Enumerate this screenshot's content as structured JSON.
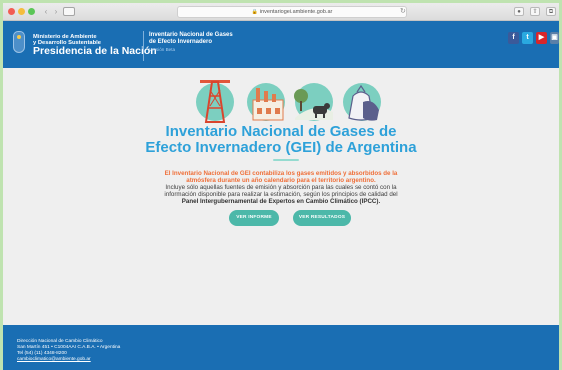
{
  "browser": {
    "url": "inventariogei.ambiente.gob.ar",
    "back_icon": "chevron-left",
    "forward_icon": "chevron-right",
    "reload_icon": "reload",
    "lock_icon": "lock"
  },
  "header": {
    "ministry_line1": "Ministerio de Ambiente",
    "ministry_line2": "y Desarrollo Sustentable",
    "presidencia": "Presidencia de la Nación",
    "inventory_line1": "Inventario Nacional de Gases",
    "inventory_line2": "de Efecto Invernadero",
    "version": "Versión Beta",
    "social": [
      "f",
      "t",
      "▶",
      "▣"
    ],
    "social_colors": [
      "#3b5a9a",
      "#2aa9e0",
      "#d8262b",
      "#5a7fa8"
    ],
    "bg_color": "#1a6eb3"
  },
  "main": {
    "title_line1": "Inventario Nacional de Gases de",
    "title_line2": "Efecto Invernadero (GEI) de Argentina",
    "lead_line1": "El Inventario Nacional de GEI contabiliza los gases emitidos y absorbidos de la",
    "lead_line2": "atmósfera durante un año calendario para el territorio argentino.",
    "body_line1": "Incluye sólo aquellas fuentes de emisión y absorción para las cuales se contó con la",
    "body_line2": "información disponible para realizar la estimación, según los principios de calidad del",
    "body_line3": "Panel Intergubernamental de Expertos en Cambio Climático (IPCC).",
    "button_report": "VER INFORME",
    "button_results": "VER RESULTADOS",
    "illustrations": [
      "energy-tower-icon",
      "industry-icon",
      "agriculture-icon",
      "waste-bag-icon"
    ],
    "title_color": "#2ea1d9",
    "lead_color": "#ef6f39",
    "button_color": "#4cb8a9"
  },
  "footer": {
    "line1": "Dirección Nacional de Cambio Climático",
    "line2": "San Martín 451 • C1004AAI C.A.B.A. • Argentina",
    "line3": "Tel (54) (11) 4348-8200",
    "line4": "cambioclimatico@ambiente.gob.ar"
  }
}
